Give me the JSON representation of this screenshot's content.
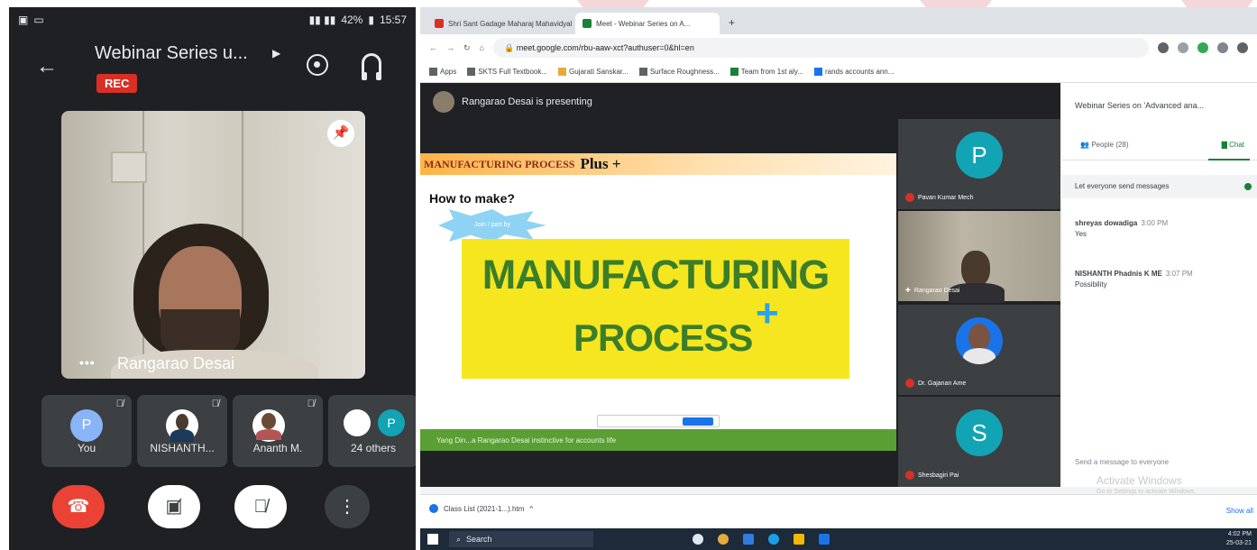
{
  "phone": {
    "status": {
      "battery": "42%",
      "time": "15:57"
    },
    "title": "Webinar Series u...",
    "rec_label": "REC",
    "presenter": "Rangarao Desai",
    "tiles": [
      {
        "avatar": "P",
        "label": "You"
      },
      {
        "avatar": "",
        "label": "NISHANTH..."
      },
      {
        "avatar": "",
        "label": "Ananth M."
      },
      {
        "avatar": "P",
        "label": "24 others"
      }
    ]
  },
  "browser": {
    "tabs": [
      "Shri Sant Gadage Maharaj Mahavidyalaya",
      "Meet - Webinar Series on A..."
    ],
    "url": "meet.google.com/rbu-aaw-xct?authuser=0&hl=en",
    "bookmarks": [
      "Apps",
      "SKTS Full Textbook...",
      "Gujarati Sanskar...",
      "Surface Roughness...",
      "Team from 1st aly...",
      "rands accounts ann..."
    ]
  },
  "meet": {
    "presenting": "Rangarao Desai is presenting",
    "participants": [
      {
        "initial": "P",
        "name": "Pavan Kumar Mech",
        "color": "#12a4b4"
      },
      {
        "initial": "",
        "name": "Rangarao Desai",
        "color": ""
      },
      {
        "initial": "",
        "name": "Dr. Gajanan Ame",
        "color": ""
      },
      {
        "initial": "S",
        "name": "Shesbagiri Pai",
        "color": "#12a4b4"
      }
    ],
    "slide": {
      "header": "MANUFACTURING PROCESS",
      "header_plus": "Plus +",
      "question": "How to make?",
      "badge": "Join / part by",
      "word1": "MANUFACTURING",
      "word2": "PROCESS",
      "cross": "+",
      "footer": "Yang Din...a Rangarao Desai instinctive for accounts life"
    }
  },
  "chat": {
    "title": "Webinar Series on 'Advanced ana...",
    "people_tab": "People (28)",
    "chat_tab": "Chat",
    "setting": "Let everyone send messages",
    "messages": [
      {
        "name": "shreyas dowadiga",
        "time": "3:00 PM",
        "text": "Yes"
      },
      {
        "name": "NISHANTH Phadnis K ME",
        "time": "3:07 PM",
        "text": "Possibility"
      }
    ],
    "input_placeholder": "Send a message to everyone",
    "watermark": "Activate Windows",
    "watermark2": "Go to Settings to activate Windows."
  },
  "downloads": {
    "file": "Class List (2021-1...).htm",
    "show_all": "Show all"
  },
  "taskbar": {
    "search": "Search",
    "time": "4:02 PM",
    "date": "25-03-21"
  }
}
